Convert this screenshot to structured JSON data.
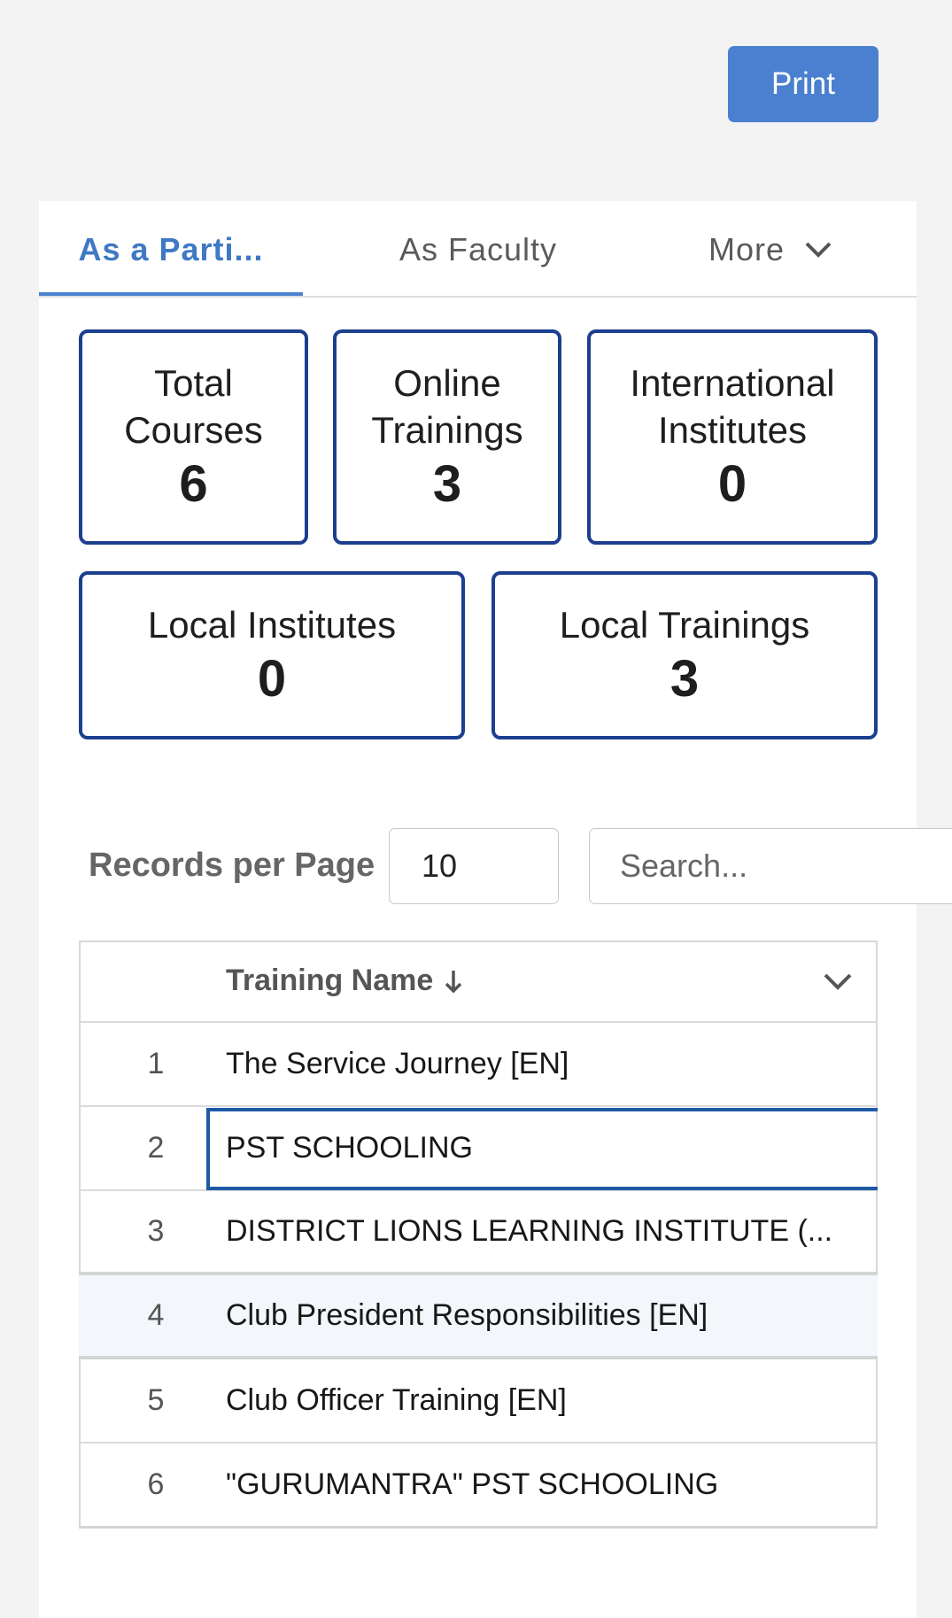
{
  "toolbar": {
    "print_label": "Print"
  },
  "tabs": [
    {
      "label": "As a Parti...",
      "active": true
    },
    {
      "label": "As Faculty",
      "active": false
    },
    {
      "label": "More",
      "icon": "chevron-down-icon"
    }
  ],
  "stats": [
    {
      "label_line1": "Total",
      "label_line2": "Courses",
      "value": "6"
    },
    {
      "label_line1": "Online",
      "label_line2": "Trainings",
      "value": "3"
    },
    {
      "label_line1": "International",
      "label_line2": "Institutes",
      "value": "0"
    },
    {
      "label_line1": "Local Institutes",
      "value": "0"
    },
    {
      "label_line1": "Local Trainings",
      "value": "3"
    }
  ],
  "controls": {
    "records_label": "Records per Page",
    "records_value": "10",
    "search_placeholder": "Search..."
  },
  "table": {
    "column": "Training Name",
    "sort_icon": "arrow-down-icon",
    "rows": [
      {
        "num": "1",
        "name": "The Service Journey [EN]"
      },
      {
        "num": "2",
        "name": "PST SCHOOLING"
      },
      {
        "num": "3",
        "name": "DISTRICT LIONS LEARNING INSTITUTE (..."
      },
      {
        "num": "4",
        "name": "Club President Responsibilities [EN]"
      },
      {
        "num": "5",
        "name": "Club Officer Training [EN]"
      },
      {
        "num": "6",
        "name": "\"GURUMANTRA\" PST SCHOOLING"
      }
    ]
  },
  "colors": {
    "accent": "#4a80cf",
    "stat_border": "#1c3f8f",
    "hover_row": "#f3f6fa"
  }
}
